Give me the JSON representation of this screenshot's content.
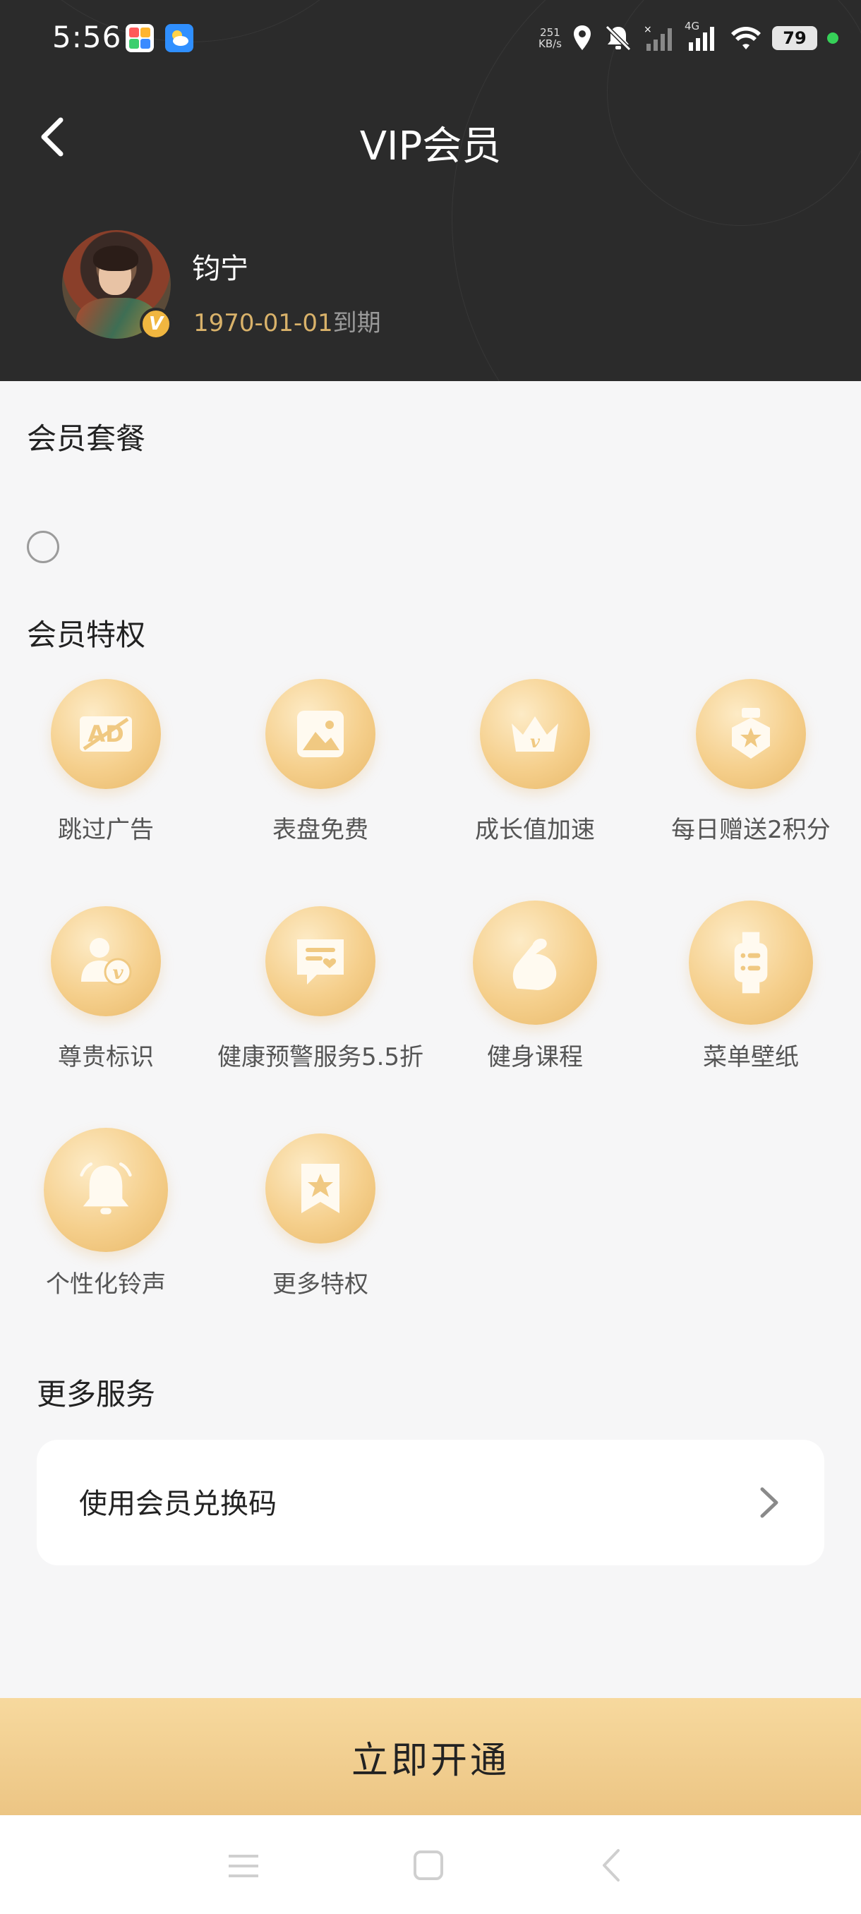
{
  "status_bar": {
    "time": "5:56",
    "net_speed_value": "251",
    "net_speed_unit": "KB/s",
    "network_type": "4G",
    "battery": "79"
  },
  "header": {
    "title": "VIP会员",
    "back_icon": "chevron-left-icon"
  },
  "user": {
    "name": "钧宁",
    "expire_date": "1970-01-01",
    "expire_suffix": "到期",
    "badge": "V"
  },
  "packages": {
    "title": "会员套餐"
  },
  "privileges": {
    "title": "会员特权",
    "items": [
      {
        "label": "跳过广告",
        "icon": "ad-skip-icon"
      },
      {
        "label": "表盘免费",
        "icon": "image-icon"
      },
      {
        "label": "成长值加速",
        "icon": "crown-icon"
      },
      {
        "label": "每日赠送2积分",
        "icon": "medal-icon"
      },
      {
        "label": "尊贵标识",
        "icon": "vip-user-icon"
      },
      {
        "label": "健康预警服务5.5折",
        "icon": "health-chat-icon"
      },
      {
        "label": "健身课程",
        "icon": "muscle-icon"
      },
      {
        "label": "菜单壁纸",
        "icon": "watch-icon"
      },
      {
        "label": "个性化铃声",
        "icon": "bell-icon"
      },
      {
        "label": "更多特权",
        "icon": "star-bookmark-icon"
      }
    ]
  },
  "more_services": {
    "title": "更多服务",
    "redeem_label": "使用会员兑换码"
  },
  "cta": {
    "label": "立即开通"
  },
  "colors": {
    "header_bg": "#2b2b2b",
    "gold": "#d9b26a",
    "cta_gold": "#f0cf8f"
  }
}
